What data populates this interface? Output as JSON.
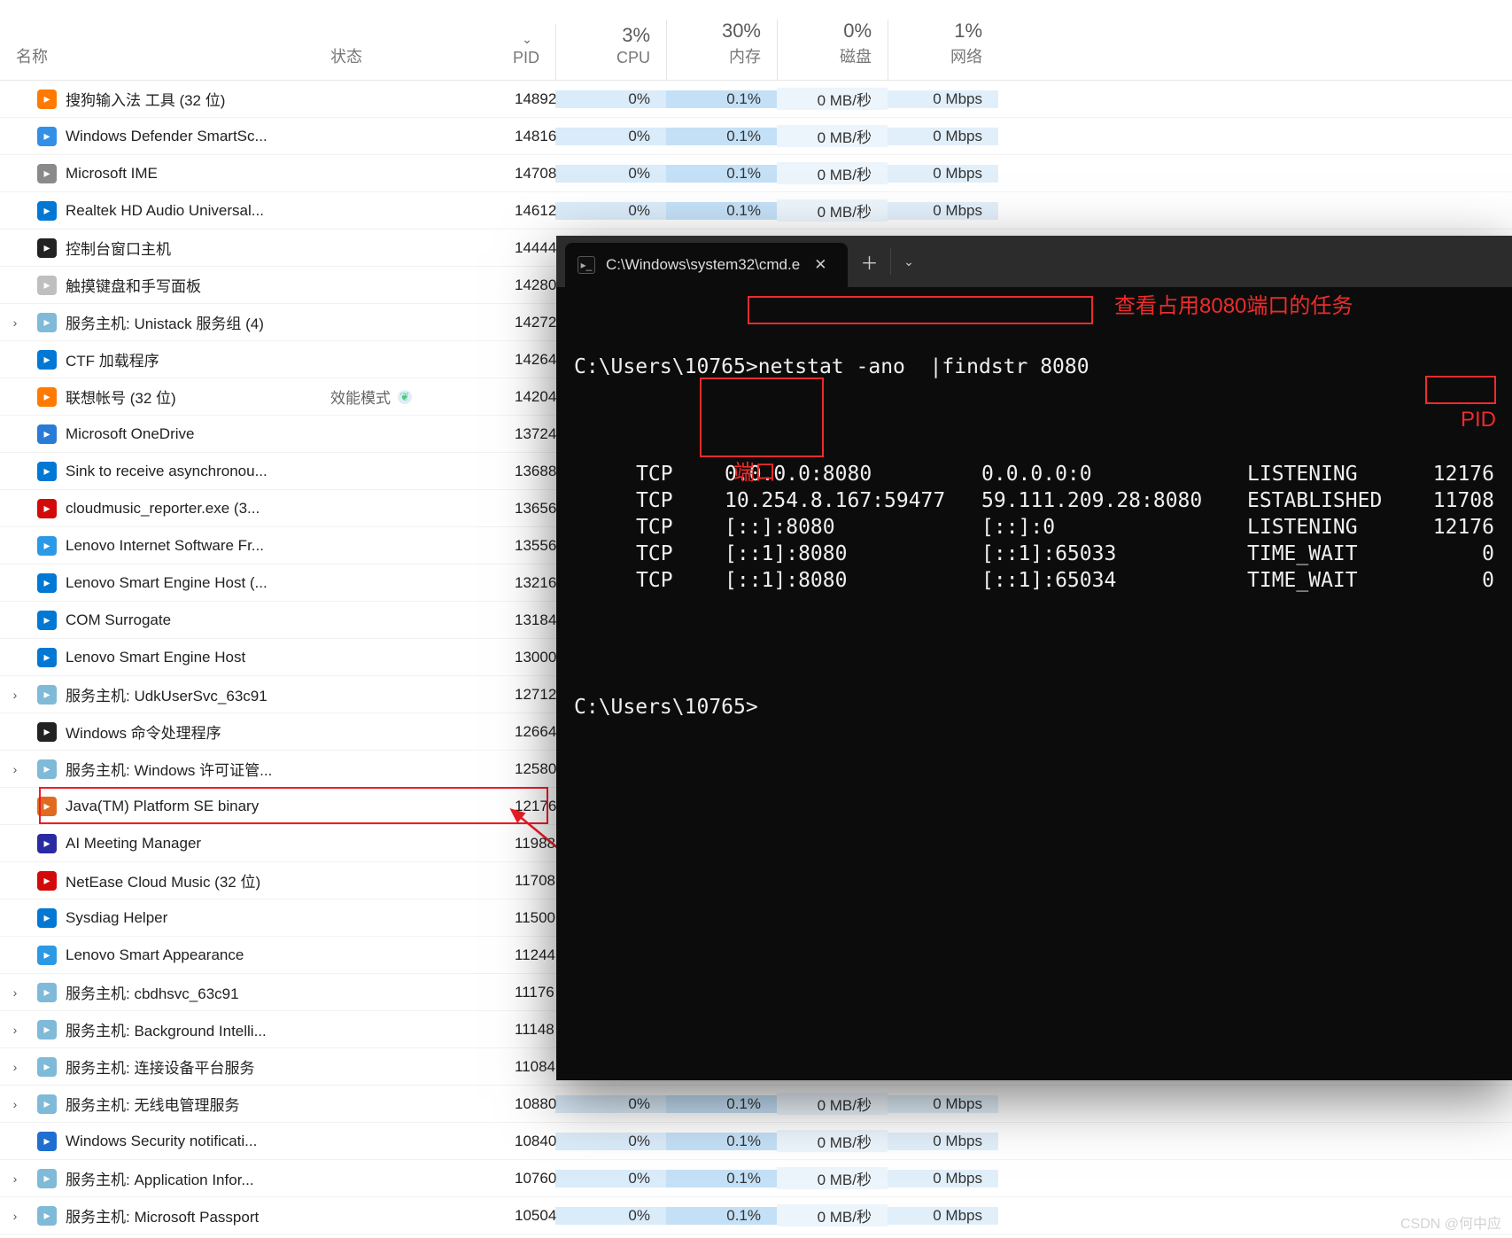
{
  "task_manager": {
    "columns": {
      "name": "名称",
      "status": "状态",
      "pid": "PID",
      "cpu_pct": "3%",
      "cpu_label": "CPU",
      "mem_pct": "30%",
      "mem_label": "内存",
      "disk_pct": "0%",
      "disk_label": "磁盘",
      "net_pct": "1%",
      "net_label": "网络"
    },
    "rows": [
      {
        "chev": "",
        "icon": "app-icon",
        "icon_bg": "#ff7a00",
        "name": "搜狗输入法 工具 (32 位)",
        "status": "",
        "leaf": false,
        "pid": "14892",
        "cpu": "0%",
        "mem": "0.1%",
        "disk": "0 MB/秒",
        "net": "0 Mbps"
      },
      {
        "chev": "",
        "icon": "shield-icon",
        "icon_bg": "#3390e6",
        "name": "Windows Defender SmartSc...",
        "status": "",
        "leaf": false,
        "pid": "14816",
        "cpu": "0%",
        "mem": "0.1%",
        "disk": "0 MB/秒",
        "net": "0 Mbps"
      },
      {
        "chev": "",
        "icon": "ime-icon",
        "icon_bg": "#8a8a8a",
        "name": "Microsoft IME",
        "status": "",
        "leaf": false,
        "pid": "14708",
        "cpu": "0%",
        "mem": "0.1%",
        "disk": "0 MB/秒",
        "net": "0 Mbps"
      },
      {
        "chev": "",
        "icon": "audio-icon",
        "icon_bg": "#0078d4",
        "name": "Realtek HD Audio Universal...",
        "status": "",
        "leaf": false,
        "pid": "14612",
        "cpu": "0%",
        "mem": "0.1%",
        "disk": "0 MB/秒",
        "net": "0 Mbps"
      },
      {
        "chev": "",
        "icon": "console-icon",
        "icon_bg": "#222222",
        "name": "控制台窗口主机",
        "status": "",
        "leaf": false,
        "pid": "14444",
        "cpu": "",
        "mem": "",
        "disk": "",
        "net": ""
      },
      {
        "chev": "",
        "icon": "touch-icon",
        "icon_bg": "#bfbfbf",
        "name": "触摸键盘和手写面板",
        "status": "",
        "leaf": false,
        "pid": "14280",
        "cpu": "",
        "mem": "",
        "disk": "",
        "net": ""
      },
      {
        "chev": "›",
        "icon": "gear-icon",
        "icon_bg": "#7fbad8",
        "name": "服务主机: Unistack 服务组 (4)",
        "status": "",
        "leaf": false,
        "pid": "14272",
        "cpu": "",
        "mem": "",
        "disk": "",
        "net": ""
      },
      {
        "chev": "",
        "icon": "ctf-icon",
        "icon_bg": "#0078d4",
        "name": "CTF 加载程序",
        "status": "",
        "leaf": false,
        "pid": "14264",
        "cpu": "",
        "mem": "",
        "disk": "",
        "net": ""
      },
      {
        "chev": "",
        "icon": "lenovo-icon",
        "icon_bg": "#ff7a00",
        "name": "联想帐号 (32 位)",
        "status": "效能模式",
        "leaf": true,
        "pid": "14204",
        "cpu": "",
        "mem": "",
        "disk": "",
        "net": ""
      },
      {
        "chev": "",
        "icon": "cloud-icon",
        "icon_bg": "#2a7bd6",
        "name": "Microsoft OneDrive",
        "status": "",
        "leaf": false,
        "pid": "13724",
        "cpu": "",
        "mem": "",
        "disk": "",
        "net": ""
      },
      {
        "chev": "",
        "icon": "sink-icon",
        "icon_bg": "#0078d4",
        "name": "Sink to receive asynchronou...",
        "status": "",
        "leaf": false,
        "pid": "13688",
        "cpu": "",
        "mem": "",
        "disk": "",
        "net": ""
      },
      {
        "chev": "",
        "icon": "music-icon",
        "icon_bg": "#d30a0a",
        "name": "cloudmusic_reporter.exe (3...",
        "status": "",
        "leaf": false,
        "pid": "13656",
        "cpu": "",
        "mem": "",
        "disk": "",
        "net": ""
      },
      {
        "chev": "",
        "icon": "globe-icon",
        "icon_bg": "#2c99e4",
        "name": "Lenovo Internet Software Fr...",
        "status": "",
        "leaf": false,
        "pid": "13556",
        "cpu": "",
        "mem": "",
        "disk": "",
        "net": ""
      },
      {
        "chev": "",
        "icon": "engine-icon",
        "icon_bg": "#0078d4",
        "name": "Lenovo Smart Engine Host (...",
        "status": "",
        "leaf": false,
        "pid": "13216",
        "cpu": "",
        "mem": "",
        "disk": "",
        "net": ""
      },
      {
        "chev": "",
        "icon": "com-icon",
        "icon_bg": "#0078d4",
        "name": "COM Surrogate",
        "status": "",
        "leaf": false,
        "pid": "13184",
        "cpu": "",
        "mem": "",
        "disk": "",
        "net": ""
      },
      {
        "chev": "",
        "icon": "engine-icon",
        "icon_bg": "#0078d4",
        "name": "Lenovo Smart Engine Host",
        "status": "",
        "leaf": false,
        "pid": "13000",
        "cpu": "",
        "mem": "",
        "disk": "",
        "net": ""
      },
      {
        "chev": "›",
        "icon": "gear-icon",
        "icon_bg": "#7fbad8",
        "name": "服务主机: UdkUserSvc_63c91",
        "status": "",
        "leaf": false,
        "pid": "12712",
        "cpu": "",
        "mem": "",
        "disk": "",
        "net": ""
      },
      {
        "chev": "",
        "icon": "cmd-icon",
        "icon_bg": "#222222",
        "name": "Windows 命令处理程序",
        "status": "",
        "leaf": false,
        "pid": "12664",
        "cpu": "",
        "mem": "",
        "disk": "",
        "net": ""
      },
      {
        "chev": "›",
        "icon": "gear-icon",
        "icon_bg": "#7fbad8",
        "name": "服务主机: Windows 许可证管...",
        "status": "",
        "leaf": false,
        "pid": "12580",
        "cpu": "",
        "mem": "",
        "disk": "",
        "net": ""
      },
      {
        "chev": "",
        "icon": "java-icon",
        "icon_bg": "#e06b1f",
        "name": "Java(TM) Platform SE binary",
        "status": "",
        "leaf": false,
        "pid": "12176",
        "cpu": "",
        "mem": "",
        "disk": "",
        "net": ""
      },
      {
        "chev": "",
        "icon": "ai-icon",
        "icon_bg": "#2a2aa2",
        "name": "AI Meeting Manager",
        "status": "",
        "leaf": false,
        "pid": "11988",
        "cpu": "",
        "mem": "",
        "disk": "",
        "net": ""
      },
      {
        "chev": "",
        "icon": "netease-icon",
        "icon_bg": "#d30a0a",
        "name": "NetEase Cloud Music (32 位)",
        "status": "",
        "leaf": false,
        "pid": "11708",
        "cpu": "",
        "mem": "",
        "disk": "",
        "net": ""
      },
      {
        "chev": "",
        "icon": "sysdiag-icon",
        "icon_bg": "#0078d4",
        "name": "Sysdiag Helper",
        "status": "",
        "leaf": false,
        "pid": "11500",
        "cpu": "",
        "mem": "",
        "disk": "",
        "net": ""
      },
      {
        "chev": "",
        "icon": "globe-icon",
        "icon_bg": "#2c99e4",
        "name": "Lenovo Smart Appearance",
        "status": "",
        "leaf": false,
        "pid": "11244",
        "cpu": "",
        "mem": "",
        "disk": "",
        "net": ""
      },
      {
        "chev": "›",
        "icon": "gear-icon",
        "icon_bg": "#7fbad8",
        "name": "服务主机: cbdhsvc_63c91",
        "status": "",
        "leaf": false,
        "pid": "11176",
        "cpu": "",
        "mem": "",
        "disk": "",
        "net": ""
      },
      {
        "chev": "›",
        "icon": "gear-icon",
        "icon_bg": "#7fbad8",
        "name": "服务主机: Background Intelli...",
        "status": "",
        "leaf": false,
        "pid": "11148",
        "cpu": "",
        "mem": "",
        "disk": "",
        "net": ""
      },
      {
        "chev": "›",
        "icon": "gear-icon",
        "icon_bg": "#7fbad8",
        "name": "服务主机: 连接设备平台服务",
        "status": "",
        "leaf": false,
        "pid": "11084",
        "cpu": "",
        "mem": "",
        "disk": "",
        "net": ""
      },
      {
        "chev": "›",
        "icon": "gear-icon",
        "icon_bg": "#7fbad8",
        "name": "服务主机: 无线电管理服务",
        "status": "",
        "leaf": false,
        "pid": "10880",
        "cpu": "0%",
        "mem": "0.1%",
        "disk": "0 MB/秒",
        "net": "0 Mbps"
      },
      {
        "chev": "",
        "icon": "shield-icon",
        "icon_bg": "#1f6fd0",
        "name": "Windows Security notificati...",
        "status": "",
        "leaf": false,
        "pid": "10840",
        "cpu": "0%",
        "mem": "0.1%",
        "disk": "0 MB/秒",
        "net": "0 Mbps"
      },
      {
        "chev": "›",
        "icon": "gear-icon",
        "icon_bg": "#7fbad8",
        "name": "服务主机: Application Infor...",
        "status": "",
        "leaf": false,
        "pid": "10760",
        "cpu": "0%",
        "mem": "0.1%",
        "disk": "0 MB/秒",
        "net": "0 Mbps"
      },
      {
        "chev": "›",
        "icon": "gear-icon",
        "icon_bg": "#7fbad8",
        "name": "服务主机: Microsoft Passport",
        "status": "",
        "leaf": false,
        "pid": "10504",
        "cpu": "0%",
        "mem": "0.1%",
        "disk": "0 MB/秒",
        "net": "0 Mbps"
      }
    ]
  },
  "cmd": {
    "tab_title": "C:\\Windows\\system32\\cmd.e",
    "prompt1_path": "C:\\Users\\10765>",
    "command": "netstat -ano  |findstr 8080",
    "prompt2": "C:\\Users\\10765>",
    "rows": [
      {
        "proto": "TCP",
        "local": "0.0.0.0:8080",
        "remote": "0.0.0.0:0",
        "state": "LISTENING",
        "pid": "12176"
      },
      {
        "proto": "TCP",
        "local": "10.254.8.167:59477",
        "remote": "59.111.209.28:8080",
        "state": "ESTABLISHED",
        "pid": "11708"
      },
      {
        "proto": "TCP",
        "local": "[::]:8080",
        "remote": "[::]:0",
        "state": "LISTENING",
        "pid": "12176"
      },
      {
        "proto": "TCP",
        "local": "[::1]:8080",
        "remote": "[::1]:65033",
        "state": "TIME_WAIT",
        "pid": "0"
      },
      {
        "proto": "TCP",
        "local": "[::1]:8080",
        "remote": "[::1]:65034",
        "state": "TIME_WAIT",
        "pid": "0"
      }
    ],
    "annotations": {
      "cmd_desc": "查看占用8080端口的任务",
      "port_label": "端口",
      "pid_label": "PID"
    }
  },
  "watermark": "CSDN @何中应"
}
